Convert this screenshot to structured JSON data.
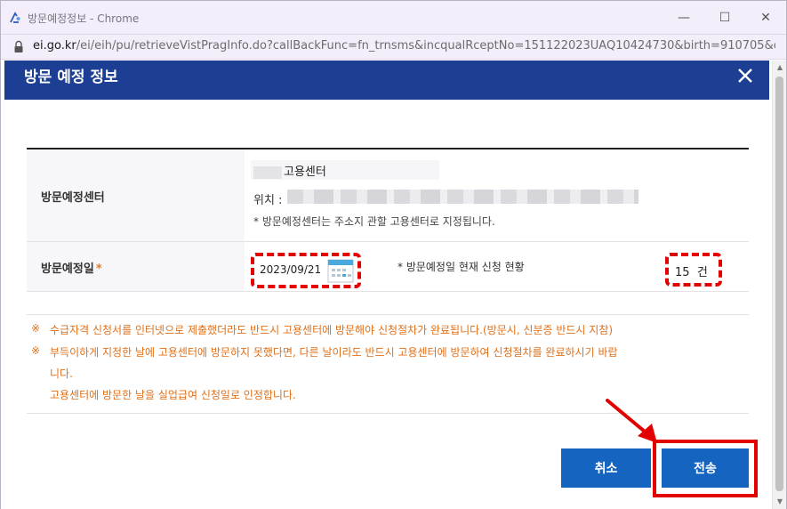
{
  "window": {
    "title": "방문예정정보 - Chrome",
    "minimize_glyph": "—",
    "maximize_glyph": "☐",
    "close_glyph": "✕"
  },
  "address": {
    "host": "ei.go.kr",
    "path": "/ei/eih/pu/retrieveVistPragInfo.do?callBackFunc=fn_trnsms&incqualRceptNo=151122023UAQ10424730&birth=910705&cl..."
  },
  "modal": {
    "title": "방문 예정 정보",
    "close_icon": "close-icon"
  },
  "form": {
    "center_label": "방문예정센터",
    "center_name": "고용센터",
    "location_label": "위치 :",
    "center_note": "* 방문예정센터는 주소지 관할 고용센터로 지정됩니다.",
    "date_label": "방문예정일",
    "required_mark": "*",
    "date_value": "2023/09/21",
    "status_label": "* 방문예정일 현재 신청 현황",
    "count_value": "15",
    "count_unit": "건"
  },
  "notices": {
    "mark": "※",
    "line1": "수급자격 신청서를 인터넷으로 제출했더라도 반드시 고용센터에 방문해야 신청절차가 완료됩니다.(방문시, 신분증 반드시 지참)",
    "line2": "부득이하게 지정한 날에 고용센터에 방문하지 못했다면, 다른 날이라도 반드시 고용센터에 방문하여 신청절차를 완료하시기 바랍",
    "line3": "니다.",
    "line4": "고용센터에 방문한 날을 실업급여 신청일로 인정합니다."
  },
  "buttons": {
    "cancel": "취소",
    "send": "전송"
  },
  "colors": {
    "header_bg": "#1d3f93",
    "button_bg": "#1565c0",
    "notice_text": "#e0701a",
    "highlight": "#e20000"
  }
}
